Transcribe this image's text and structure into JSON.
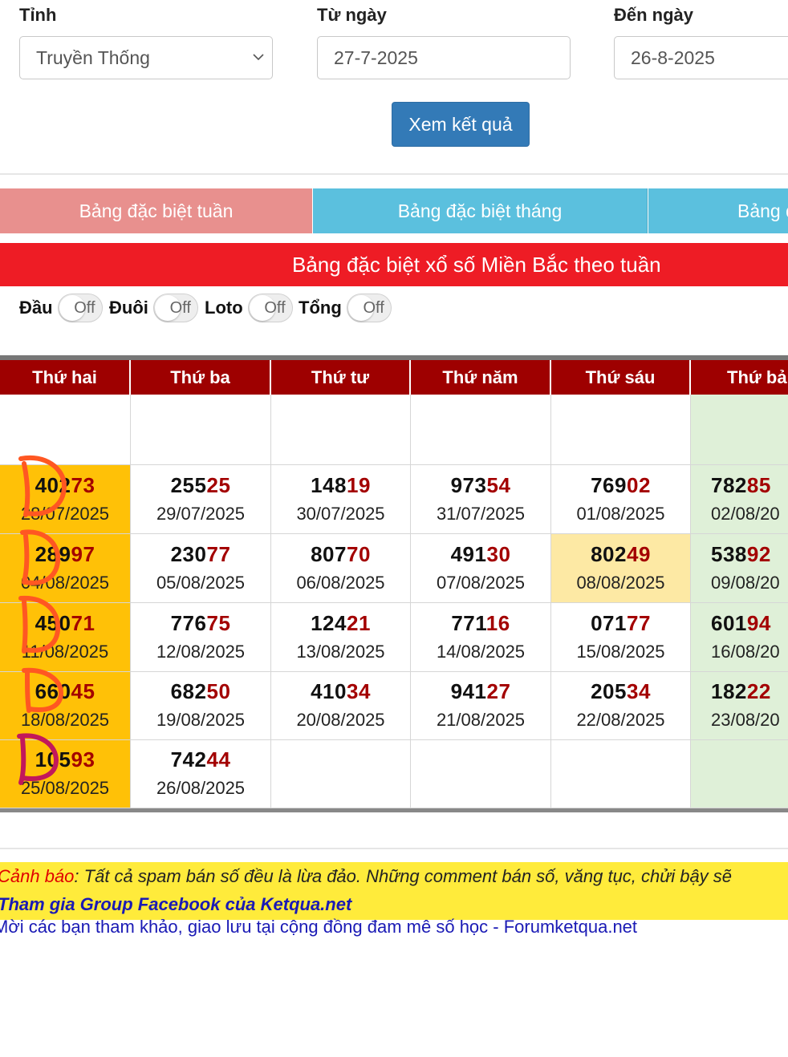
{
  "filters": {
    "province_label": "Tỉnh",
    "province_value": "Truyền Thống",
    "from_label": "Từ ngày",
    "from_value": "27-7-2025",
    "to_label": "Đến ngày",
    "to_value": "26-8-2025",
    "submit_label": "Xem kết quả"
  },
  "tabs": [
    {
      "label": "Bảng đặc biệt tuần",
      "color": "#e8908e"
    },
    {
      "label": "Bảng đặc biệt tháng",
      "color": "#5bc0de"
    },
    {
      "label": "Bảng đ",
      "color": "#5bc0de"
    }
  ],
  "banner": {
    "title": "Bảng đặc biệt xổ số Miền Bắc theo tuần",
    "color": "#ee1c25"
  },
  "toggles": [
    {
      "label": "Đầu",
      "state": "Off"
    },
    {
      "label": "Đuôi",
      "state": "Off"
    },
    {
      "label": "Loto",
      "state": "Off"
    },
    {
      "label": "Tổng",
      "state": "Off"
    }
  ],
  "table": {
    "headers": [
      "Thứ hai",
      "Thứ ba",
      "Thứ tư",
      "Thứ năm",
      "Thứ sáu",
      "Thứ bả"
    ],
    "rows": [
      [
        null,
        null,
        null,
        null,
        null,
        null
      ],
      [
        {
          "head": "402",
          "tail": "73",
          "date": "28/07/2025"
        },
        {
          "head": "255",
          "tail": "25",
          "date": "29/07/2025"
        },
        {
          "head": "148",
          "tail": "19",
          "date": "30/07/2025"
        },
        {
          "head": "973",
          "tail": "54",
          "date": "31/07/2025"
        },
        {
          "head": "769",
          "tail": "02",
          "date": "01/08/2025"
        },
        {
          "head": "782",
          "tail": "85",
          "date": "02/08/20"
        }
      ],
      [
        {
          "head": "289",
          "tail": "97",
          "date": "04/08/2025"
        },
        {
          "head": "230",
          "tail": "77",
          "date": "05/08/2025"
        },
        {
          "head": "807",
          "tail": "70",
          "date": "06/08/2025"
        },
        {
          "head": "491",
          "tail": "30",
          "date": "07/08/2025"
        },
        {
          "head": "802",
          "tail": "49",
          "date": "08/08/2025",
          "highlight": true
        },
        {
          "head": "538",
          "tail": "92",
          "date": "09/08/20"
        }
      ],
      [
        {
          "head": "450",
          "tail": "71",
          "date": "11/08/2025"
        },
        {
          "head": "776",
          "tail": "75",
          "date": "12/08/2025"
        },
        {
          "head": "124",
          "tail": "21",
          "date": "13/08/2025"
        },
        {
          "head": "771",
          "tail": "16",
          "date": "14/08/2025"
        },
        {
          "head": "071",
          "tail": "77",
          "date": "15/08/2025"
        },
        {
          "head": "601",
          "tail": "94",
          "date": "16/08/20"
        }
      ],
      [
        {
          "head": "660",
          "tail": "45",
          "date": "18/08/2025"
        },
        {
          "head": "682",
          "tail": "50",
          "date": "19/08/2025"
        },
        {
          "head": "410",
          "tail": "34",
          "date": "20/08/2025"
        },
        {
          "head": "941",
          "tail": "27",
          "date": "21/08/2025"
        },
        {
          "head": "205",
          "tail": "34",
          "date": "22/08/2025"
        },
        {
          "head": "182",
          "tail": "22",
          "date": "23/08/20"
        }
      ],
      [
        {
          "head": "105",
          "tail": "93",
          "date": "25/08/2025"
        },
        {
          "head": "742",
          "tail": "44",
          "date": "26/08/2025"
        },
        null,
        null,
        null,
        null
      ]
    ],
    "colors": {
      "monday": "#ffc107",
      "saturday": "#dff0d8",
      "highlight": "#fde9a4",
      "header": "#9e0000",
      "tail": "#a30000"
    }
  },
  "warning": {
    "prefix": "Cảnh báo",
    "text": ": Tất cả spam bán số đều là lừa đảo. Những comment bán số, văng tục, chửi bậy sẽ",
    "group_link": "Tham gia Group Facebook của Ketqua.net"
  },
  "forum_link": "Mời các bạn tham khảo, giao lưu tại cộng đồng đam mê số học - Forumketqua.net"
}
